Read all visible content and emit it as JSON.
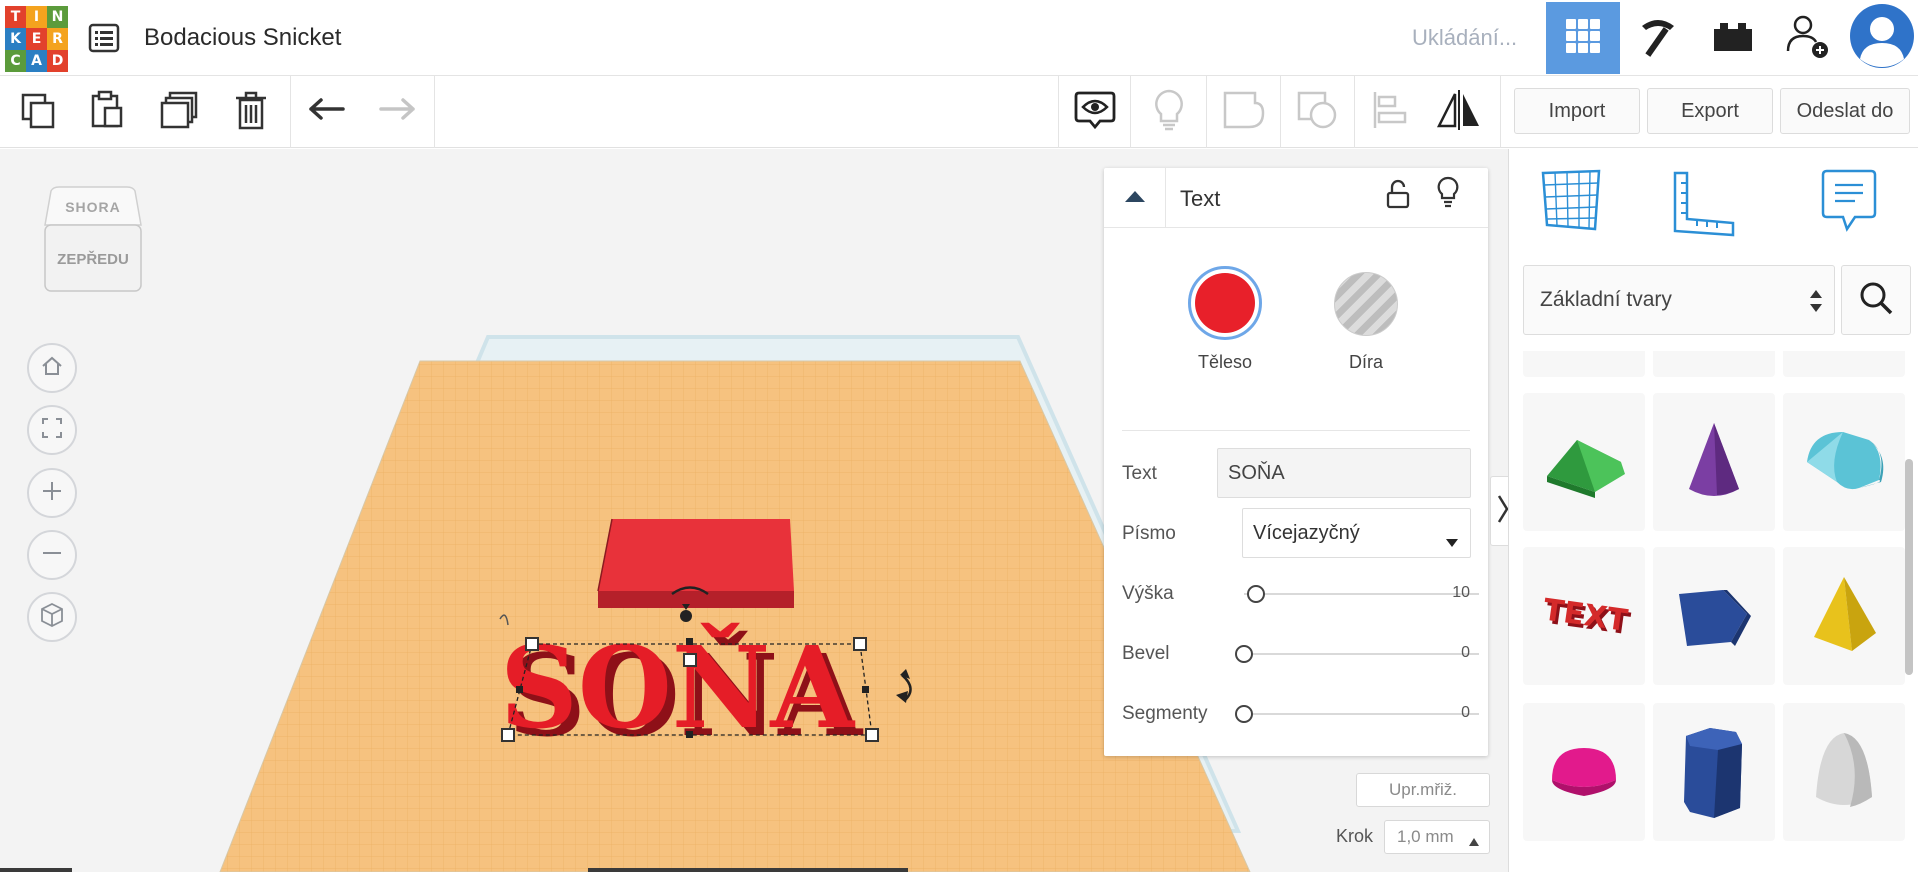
{
  "app": {
    "logo_letters": [
      "T",
      "I",
      "N",
      "K",
      "E",
      "R",
      "C",
      "A",
      "D"
    ],
    "logo_colors": [
      "#e2412c",
      "#f4a31e",
      "#5b9b3b",
      "#2b7fc3",
      "#e2412c",
      "#f4a31e",
      "#5b9b3b",
      "#2b7fc3",
      "#e2412c"
    ],
    "design_title": "Bodacious Snicket",
    "status": "Ukládání...",
    "accent": "#4a90d9"
  },
  "topbar_icons": [
    "design-list-icon",
    "grid-view-icon",
    "pickaxe-icon",
    "bricks-icon",
    "add-user-icon",
    "user-avatar-icon"
  ],
  "toolbar": {
    "import_label": "Import",
    "export_label": "Export",
    "send_label": "Odeslat do",
    "icons": [
      "copy-icon",
      "paste-icon",
      "duplicate-icon",
      "delete-icon",
      "undo-icon",
      "redo-icon",
      "visibility-icon",
      "lightbulb-icon",
      "group-icon",
      "ungroup-icon",
      "align-icon",
      "mirror-icon"
    ]
  },
  "viewcube": {
    "top": "SHORA",
    "front": "ZEPŘEDU"
  },
  "nav_buttons": [
    "home-icon",
    "fit-icon",
    "zoom-in-icon",
    "zoom-out-icon",
    "perspective-icon"
  ],
  "scene": {
    "text_object": "SOŇA",
    "plane_color": "#f6c27f",
    "object_color": "#e8202a"
  },
  "inspector": {
    "title": "Text",
    "solid_label": "Těleso",
    "hole_label": "Díra",
    "solid_color": "#e8202a",
    "fields": {
      "text_label": "Text",
      "text_value": "SOŇA",
      "font_label": "Písmo",
      "font_value": "Vícejazyčný",
      "height_label": "Výška",
      "height_value": "10",
      "height_fraction": 0.05,
      "bevel_label": "Bevel",
      "bevel_value": "0",
      "bevel_fraction": 0,
      "segments_label": "Segmenty",
      "segments_value": "0",
      "segments_fraction": 0
    }
  },
  "grid": {
    "edit_grid_label": "Upr.mřiž.",
    "step_label": "Krok",
    "step_value": "1,0 mm"
  },
  "shapes_panel": {
    "category": "Základní tvary",
    "tab_icons": [
      "workplane-icon",
      "ruler-icon",
      "notes-icon"
    ],
    "shapes": [
      {
        "name": "roof",
        "color": "#3aa34a"
      },
      {
        "name": "cone",
        "color": "#7b3ea3"
      },
      {
        "name": "half-cylinder",
        "color": "#5bc3d6"
      },
      {
        "name": "text",
        "color": "#d42a2a"
      },
      {
        "name": "polygon",
        "color": "#2a4c9a"
      },
      {
        "name": "pyramid",
        "color": "#e8c21c"
      },
      {
        "name": "half-sphere",
        "color": "#e21a8c"
      },
      {
        "name": "hexagonal-prism",
        "color": "#2a4c9a"
      },
      {
        "name": "paraboloid",
        "color": "#d7d7d7"
      }
    ],
    "text_shape_label": "TEXT"
  }
}
